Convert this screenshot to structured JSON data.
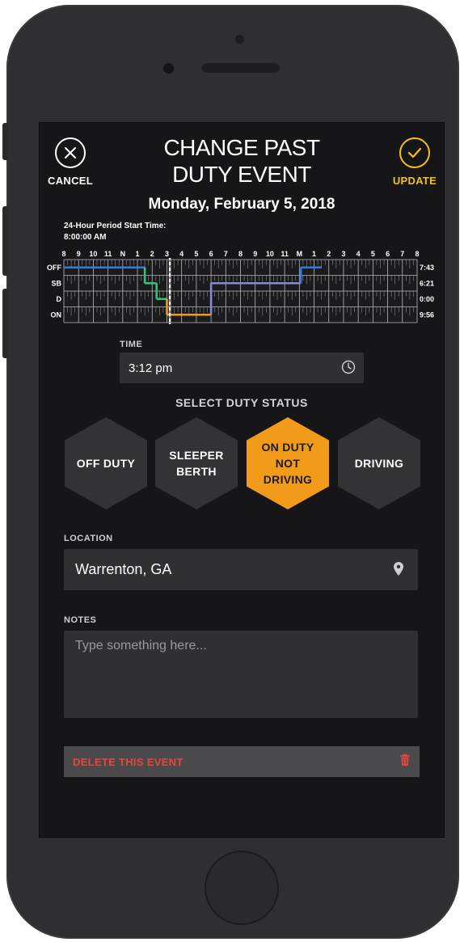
{
  "header": {
    "cancel_label": "CANCEL",
    "update_label": "UPDATE",
    "title_line1": "CHANGE PAST",
    "title_line2": "DUTY EVENT"
  },
  "date": "Monday, February 5, 2018",
  "period": {
    "label": "24-Hour Period Start Time:",
    "value": "8:00:00 AM"
  },
  "graph": {
    "hour_labels": [
      "8",
      "9",
      "10",
      "11",
      "N",
      "1",
      "2",
      "3",
      "4",
      "5",
      "6",
      "7",
      "8",
      "9",
      "10",
      "11",
      "M",
      "1",
      "2",
      "3",
      "4",
      "5",
      "6",
      "7",
      "8"
    ],
    "rows": [
      {
        "label": "OFF",
        "total": "7:43"
      },
      {
        "label": "SB",
        "total": "6:21"
      },
      {
        "label": "D",
        "total": "0:00"
      },
      {
        "label": "ON",
        "total": "9:56"
      }
    ],
    "selected_time_hours": 7.2,
    "segments": [
      {
        "row": 0,
        "start": 0,
        "end": 5.5,
        "color": "#2f7fe0"
      },
      {
        "row": 1,
        "start": 5.5,
        "end": 6.3,
        "color": "#31c27c"
      },
      {
        "row": 2,
        "start": 6.3,
        "end": 7.0,
        "color": "#31c27c"
      },
      {
        "row": 3,
        "start": 7.0,
        "end": 10.0,
        "color": "#f29b1b"
      },
      {
        "row": 1,
        "start": 10.0,
        "end": 16.1,
        "color": "#8a86d8"
      },
      {
        "row": 0,
        "start": 16.1,
        "end": 17.5,
        "color": "#2f7fe0"
      }
    ]
  },
  "time": {
    "label": "TIME",
    "value": "3:12 pm"
  },
  "duty_status": {
    "heading": "SELECT DUTY STATUS",
    "options": [
      {
        "line1": "OFF DUTY",
        "line2": "",
        "line3": "",
        "selected": false
      },
      {
        "line1": "SLEEPER",
        "line2": "BERTH",
        "line3": "",
        "selected": false
      },
      {
        "line1": "ON DUTY",
        "line2": "NOT",
        "line3": "DRIVING",
        "selected": true
      },
      {
        "line1": "DRIVING",
        "line2": "",
        "line3": "",
        "selected": false
      }
    ]
  },
  "location": {
    "label": "LOCATION",
    "value": "Warrenton, GA"
  },
  "notes": {
    "label": "NOTES",
    "placeholder": "Type something here..."
  },
  "delete_label": "DELETE THIS EVENT",
  "colors": {
    "accent": "#f2c314",
    "selected": "#f29b1b",
    "delete_text": "#e8463a"
  }
}
